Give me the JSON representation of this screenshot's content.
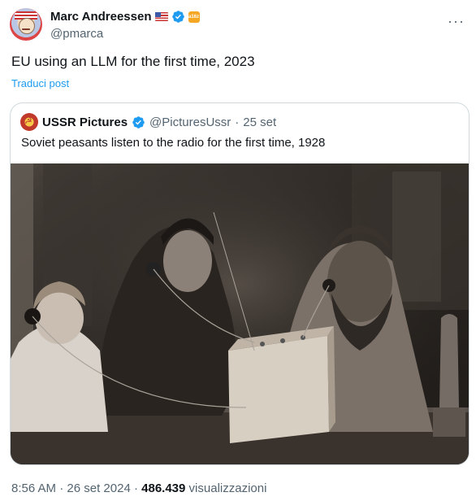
{
  "author": {
    "name": "Marc Andreessen",
    "handle": "@pmarca",
    "flag_icon": "us-flag-icon",
    "verified_icon": "verified-badge-icon",
    "affiliate_badge": "a16z",
    "more_label": "···"
  },
  "tweet": {
    "text": "EU using an LLM for the first time, 2023",
    "translate_label": "Traduci post"
  },
  "quoted": {
    "name": "USSR Pictures",
    "handle": "@PicturesUssr",
    "separator": "·",
    "date": "25 set",
    "text": "Soviet peasants listen to the radio for the first time, 1928",
    "image_description_icon": "sepia-photo-icon"
  },
  "meta": {
    "time": "8:56 AM",
    "dot1": "·",
    "date": "26 set 2024",
    "dot2": "·",
    "views": "486.439",
    "views_label": "visualizzazioni"
  },
  "colors": {
    "link": "#1d9bf0",
    "secondary_text": "#536471",
    "border": "#cfd9de"
  }
}
